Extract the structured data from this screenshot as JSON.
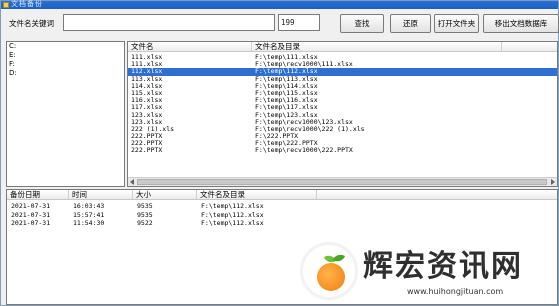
{
  "window": {
    "title": "文档备份"
  },
  "toolbar": {
    "keyword_label": "文件名关键词",
    "keyword_value": "",
    "count": "199",
    "buttons": {
      "search": "查找",
      "restore": "还原",
      "open_folder": "打开文件夹",
      "remove_db": "移出文档数据库"
    }
  },
  "drives": [
    "C:",
    "E:",
    "F:",
    "D:"
  ],
  "file_list": {
    "headers": {
      "name": "文件名",
      "path": "文件名及目录"
    },
    "rows": [
      {
        "name": "111.xlsx",
        "path": "F:\\temp\\111.xlsx"
      },
      {
        "name": "111.xlsx",
        "path": "F:\\temp\\recv1000\\111.xlsx"
      },
      {
        "name": "112.xlsx",
        "path": "F:\\temp\\112.xlsx"
      },
      {
        "name": "113.xlsx",
        "path": "F:\\temp\\113.xlsx"
      },
      {
        "name": "114.xlsx",
        "path": "F:\\temp\\114.xlsx"
      },
      {
        "name": "115.xlsx",
        "path": "F:\\temp\\115.xlsx"
      },
      {
        "name": "116.xlsx",
        "path": "F:\\temp\\116.xlsx"
      },
      {
        "name": "117.xlsx",
        "path": "F:\\temp\\117.xlsx"
      },
      {
        "name": "123.xlsx",
        "path": "F:\\temp\\123.xlsx"
      },
      {
        "name": "123.xlsx",
        "path": "F:\\temp\\recv1000\\123.xlsx"
      },
      {
        "name": "222 (1).xls",
        "path": "F:\\temp\\recv1000\\222 (1).xls"
      },
      {
        "name": "222.PPTX",
        "path": "F:\\222.PPTX"
      },
      {
        "name": "222.PPTX",
        "path": "F:\\temp\\222.PPTX"
      },
      {
        "name": "222.PPTX",
        "path": "F:\\temp\\recv1000\\222.PPTX"
      }
    ],
    "selected_index": 2
  },
  "backups": {
    "headers": {
      "date": "备份日期",
      "time": "时间",
      "size": "大小",
      "path": "文件名及目录"
    },
    "rows": [
      {
        "date": "2021-07-31",
        "time": "16:03:43",
        "size": "9535",
        "path": "F:\\temp\\112.xlsx"
      },
      {
        "date": "2021-07-31",
        "time": "15:57:41",
        "size": "9535",
        "path": "F:\\temp\\112.xlsx"
      },
      {
        "date": "2021-07-31",
        "time": "11:54:30",
        "size": "9522",
        "path": "F:\\temp\\112.xlsx"
      }
    ]
  },
  "watermark": {
    "text": "辉宏资讯网",
    "url": "www.huihongjituan.com"
  },
  "colors": {
    "selection": "#2f6fd1",
    "titlebar": "#1f5fc2"
  },
  "icons": {
    "app": "app-icon",
    "scroll_left": "arrow-left-icon",
    "scroll_right": "arrow-right-icon",
    "logo": "orange-logo-icon"
  }
}
